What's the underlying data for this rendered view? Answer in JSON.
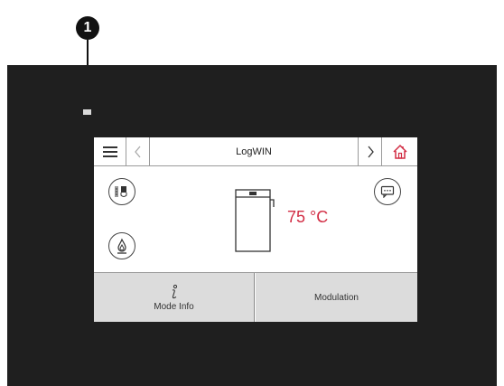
{
  "callout": {
    "number": "1"
  },
  "screen": {
    "title": "LogWIN",
    "temperature": "75 °C",
    "icons": {
      "menu": "menu-icon",
      "back": "chevron-left-icon",
      "forward": "chevron-right-icon",
      "home": "home-icon",
      "buffer": "buffer-tank-icon",
      "flame": "flame-icon",
      "message": "message-icon",
      "boiler": "boiler-icon",
      "info": "info-icon"
    },
    "bottom_buttons": {
      "mode_info": "Mode Info",
      "modulation": "Modulation"
    },
    "colors": {
      "accent": "#d22d44",
      "home_icon": "#d22d44",
      "button_bg": "#dcdcdc",
      "frame_bg": "#1f1f1f"
    }
  }
}
